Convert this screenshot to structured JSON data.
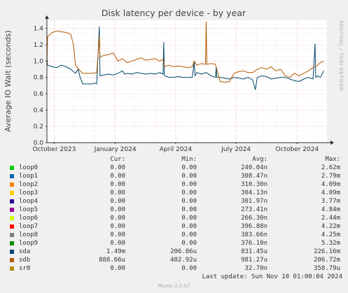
{
  "chart_data": {
    "type": "line",
    "title": "Disk latency per device - by year",
    "ylabel": "Average IO Wait (seconds)",
    "xlabel": "",
    "ylim": [
      0,
      1.5
    ],
    "yticks": [
      0.0,
      0.2,
      0.4,
      0.6,
      0.8,
      1.0,
      1.2,
      1.4
    ],
    "ytick_labels": [
      "0.0",
      "0.2",
      "0.4",
      "0.6",
      "0.8",
      "1.0",
      "1.2",
      "1.4"
    ],
    "xlim": [
      "2023-09-20",
      "2024-11-15"
    ],
    "xticks": [
      {
        "date": "2023-10-01",
        "label": "October 2023"
      },
      {
        "date": "2024-01-01",
        "label": "January 2024"
      },
      {
        "date": "2024-04-01",
        "label": "April 2024"
      },
      {
        "date": "2024-07-01",
        "label": "July 2024"
      },
      {
        "date": "2024-10-01",
        "label": "October 2024"
      }
    ],
    "grid": true,
    "series": [
      {
        "name": "sda",
        "color": "#00486a",
        "points": [
          [
            "2023-09-20",
            1.05
          ],
          [
            "2023-09-21",
            0.95
          ],
          [
            "2023-09-28",
            0.93
          ],
          [
            "2023-10-05",
            0.92
          ],
          [
            "2023-10-12",
            0.95
          ],
          [
            "2023-10-19",
            0.93
          ],
          [
            "2023-10-26",
            0.9
          ],
          [
            "2023-11-02",
            0.85
          ],
          [
            "2023-11-06",
            0.9
          ],
          [
            "2023-11-09",
            0.8
          ],
          [
            "2023-11-13",
            0.72
          ],
          [
            "2023-11-20",
            0.72
          ],
          [
            "2023-11-27",
            0.72
          ],
          [
            "2023-12-01",
            0.73
          ],
          [
            "2023-12-04",
            0.72
          ],
          [
            "2023-12-08",
            1.42
          ],
          [
            "2023-12-09",
            0.82
          ],
          [
            "2023-12-15",
            0.83
          ],
          [
            "2023-12-22",
            0.84
          ],
          [
            "2023-12-29",
            0.83
          ],
          [
            "2024-01-05",
            0.85
          ],
          [
            "2024-01-12",
            0.88
          ],
          [
            "2024-01-15",
            0.84
          ],
          [
            "2024-01-19",
            0.85
          ],
          [
            "2024-01-26",
            0.84
          ],
          [
            "2024-02-02",
            0.86
          ],
          [
            "2024-02-09",
            0.85
          ],
          [
            "2024-02-16",
            0.84
          ],
          [
            "2024-02-23",
            0.85
          ],
          [
            "2024-03-01",
            0.84
          ],
          [
            "2024-03-08",
            0.86
          ],
          [
            "2024-03-13",
            0.84
          ],
          [
            "2024-03-14",
            1.23
          ],
          [
            "2024-03-15",
            0.82
          ],
          [
            "2024-03-22",
            0.8
          ],
          [
            "2024-03-29",
            0.8
          ],
          [
            "2024-04-05",
            0.81
          ],
          [
            "2024-04-12",
            0.8
          ],
          [
            "2024-04-19",
            0.8
          ],
          [
            "2024-04-26",
            0.8
          ],
          [
            "2024-04-29",
            0.99
          ],
          [
            "2024-04-30",
            0.82
          ],
          [
            "2024-05-03",
            0.86
          ],
          [
            "2024-05-10",
            0.84
          ],
          [
            "2024-05-17",
            0.86
          ],
          [
            "2024-05-24",
            0.82
          ],
          [
            "2024-05-31",
            0.8
          ],
          [
            "2024-06-01",
            0.92
          ],
          [
            "2024-06-02",
            0.8
          ],
          [
            "2024-06-07",
            0.8
          ],
          [
            "2024-06-14",
            0.79
          ],
          [
            "2024-06-21",
            0.78
          ],
          [
            "2024-06-28",
            0.8
          ],
          [
            "2024-07-05",
            0.79
          ],
          [
            "2024-07-12",
            0.78
          ],
          [
            "2024-07-19",
            0.8
          ],
          [
            "2024-07-26",
            0.77
          ],
          [
            "2024-07-30",
            0.65
          ],
          [
            "2024-08-02",
            0.8
          ],
          [
            "2024-08-09",
            0.82
          ],
          [
            "2024-08-16",
            0.81
          ],
          [
            "2024-08-23",
            0.78
          ],
          [
            "2024-08-30",
            0.79
          ],
          [
            "2024-09-06",
            0.8
          ],
          [
            "2024-09-13",
            0.8
          ],
          [
            "2024-09-20",
            0.78
          ],
          [
            "2024-09-27",
            0.76
          ],
          [
            "2024-10-04",
            0.75
          ],
          [
            "2024-10-11",
            0.78
          ],
          [
            "2024-10-18",
            0.8
          ],
          [
            "2024-10-25",
            0.78
          ],
          [
            "2024-10-28",
            1.21
          ],
          [
            "2024-10-29",
            0.8
          ],
          [
            "2024-11-01",
            0.82
          ],
          [
            "2024-11-05",
            0.8
          ],
          [
            "2024-11-10",
            0.88
          ]
        ]
      },
      {
        "name": "sdb",
        "color": "#b35a00",
        "points": [
          [
            "2023-09-20",
            0.9
          ],
          [
            "2023-09-21",
            1.3
          ],
          [
            "2023-09-28",
            1.35
          ],
          [
            "2023-10-05",
            1.37
          ],
          [
            "2023-10-12",
            1.36
          ],
          [
            "2023-10-19",
            1.35
          ],
          [
            "2023-10-26",
            1.33
          ],
          [
            "2023-10-30",
            1.2
          ],
          [
            "2023-11-02",
            0.95
          ],
          [
            "2023-11-09",
            0.88
          ],
          [
            "2023-11-13",
            0.85
          ],
          [
            "2023-11-20",
            0.85
          ],
          [
            "2023-11-27",
            0.85
          ],
          [
            "2023-12-04",
            0.86
          ],
          [
            "2023-12-08",
            1.3
          ],
          [
            "2023-12-09",
            1.05
          ],
          [
            "2023-12-15",
            1.07
          ],
          [
            "2023-12-22",
            1.08
          ],
          [
            "2023-12-29",
            1.1
          ],
          [
            "2024-01-05",
            1.0
          ],
          [
            "2024-01-12",
            1.03
          ],
          [
            "2024-01-19",
            0.98
          ],
          [
            "2024-01-26",
            1.0
          ],
          [
            "2024-02-02",
            1.02
          ],
          [
            "2024-02-09",
            1.04
          ],
          [
            "2024-02-16",
            1.01
          ],
          [
            "2024-02-23",
            1.02
          ],
          [
            "2024-03-01",
            1.03
          ],
          [
            "2024-03-08",
            1.0
          ],
          [
            "2024-03-13",
            1.02
          ],
          [
            "2024-03-15",
            0.93
          ],
          [
            "2024-03-22",
            0.95
          ],
          [
            "2024-03-29",
            0.93
          ],
          [
            "2024-04-05",
            0.94
          ],
          [
            "2024-04-12",
            0.93
          ],
          [
            "2024-04-19",
            0.92
          ],
          [
            "2024-04-26",
            0.93
          ],
          [
            "2024-04-29",
            1.0
          ],
          [
            "2024-05-03",
            0.95
          ],
          [
            "2024-05-10",
            0.97
          ],
          [
            "2024-05-16",
            0.96
          ],
          [
            "2024-05-17",
            1.48
          ],
          [
            "2024-05-18",
            0.96
          ],
          [
            "2024-05-24",
            0.97
          ],
          [
            "2024-05-31",
            0.96
          ],
          [
            "2024-06-07",
            0.75
          ],
          [
            "2024-06-14",
            0.74
          ],
          [
            "2024-06-21",
            0.75
          ],
          [
            "2024-06-28",
            0.85
          ],
          [
            "2024-07-05",
            0.87
          ],
          [
            "2024-07-12",
            0.88
          ],
          [
            "2024-07-19",
            0.86
          ],
          [
            "2024-07-26",
            0.86
          ],
          [
            "2024-08-02",
            0.9
          ],
          [
            "2024-08-09",
            0.92
          ],
          [
            "2024-08-16",
            0.9
          ],
          [
            "2024-08-23",
            0.93
          ],
          [
            "2024-08-30",
            0.88
          ],
          [
            "2024-09-06",
            0.9
          ],
          [
            "2024-09-13",
            0.82
          ],
          [
            "2024-09-20",
            0.8
          ],
          [
            "2024-09-27",
            0.85
          ],
          [
            "2024-10-04",
            0.82
          ],
          [
            "2024-10-11",
            0.85
          ],
          [
            "2024-10-18",
            0.88
          ],
          [
            "2024-10-25",
            0.92
          ],
          [
            "2024-11-01",
            0.95
          ],
          [
            "2024-11-05",
            0.98
          ],
          [
            "2024-11-10",
            1.0
          ]
        ]
      }
    ]
  },
  "side_label": "RRDTOOL / TOBI OETIKER",
  "legend": {
    "headers": {
      "cur": "Cur:",
      "min": "Min:",
      "avg": "Avg:",
      "max": "Max:"
    },
    "rows": [
      {
        "name": "loop0",
        "color": "#00cc00",
        "cur": "0.00",
        "min": "0.00",
        "avg": "240.04n",
        "max": "2.62m"
      },
      {
        "name": "loop1",
        "color": "#0066b3",
        "cur": "0.00",
        "min": "0.00",
        "avg": "308.47n",
        "max": "2.79m"
      },
      {
        "name": "loop2",
        "color": "#ff8000",
        "cur": "0.00",
        "min": "0.00",
        "avg": "310.30n",
        "max": "4.09m"
      },
      {
        "name": "loop3",
        "color": "#ffcc00",
        "cur": "0.00",
        "min": "0.00",
        "avg": "304.13n",
        "max": "4.09m"
      },
      {
        "name": "loop4",
        "color": "#330099",
        "cur": "0.00",
        "min": "0.00",
        "avg": "301.97n",
        "max": "3.77m"
      },
      {
        "name": "loop5",
        "color": "#990099",
        "cur": "0.00",
        "min": "0.00",
        "avg": "273.41n",
        "max": "4.84m"
      },
      {
        "name": "loop6",
        "color": "#ccff00",
        "cur": "0.00",
        "min": "0.00",
        "avg": "266.30n",
        "max": "2.44m"
      },
      {
        "name": "loop7",
        "color": "#ff0000",
        "cur": "0.00",
        "min": "0.00",
        "avg": "396.88n",
        "max": "4.22m"
      },
      {
        "name": "loop8",
        "color": "#808080",
        "cur": "0.00",
        "min": "0.00",
        "avg": "383.66n",
        "max": "4.25m"
      },
      {
        "name": "loop9",
        "color": "#008f00",
        "cur": "0.00",
        "min": "0.00",
        "avg": "376.10n",
        "max": "5.32m"
      },
      {
        "name": "sda",
        "color": "#00487d",
        "cur": "1.49m",
        "min": "206.86u",
        "avg": "831.45u",
        "max": "226.16m"
      },
      {
        "name": "sdb",
        "color": "#b35a00",
        "cur": "888.66u",
        "min": "402.92u",
        "avg": "981.27u",
        "max": "206.72m"
      },
      {
        "name": "sr0",
        "color": "#b38f00",
        "cur": "0.00",
        "min": "0.00",
        "avg": "32.70n",
        "max": "358.79u"
      }
    ]
  },
  "footer": {
    "last_update": "Last update: Sun Nov 10 01:00:04 2024",
    "munin": "Munin 2.0.57"
  }
}
